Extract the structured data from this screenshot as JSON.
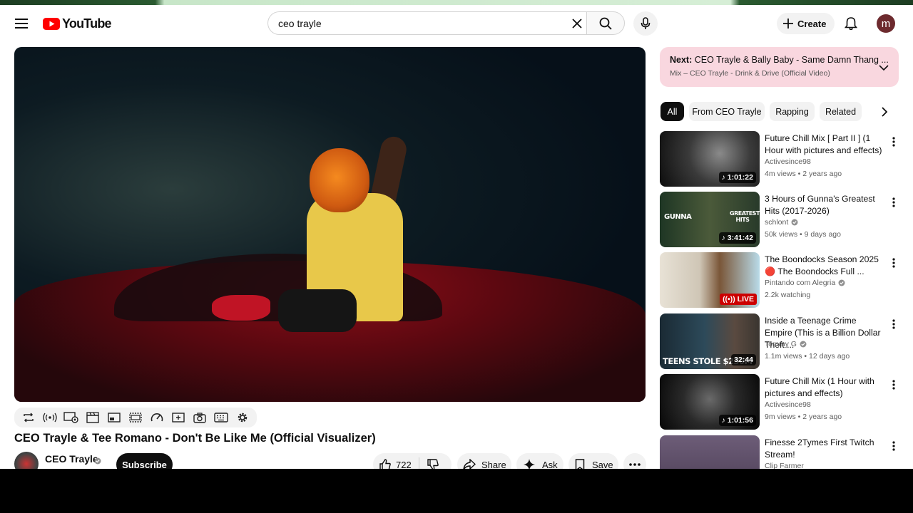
{
  "header": {
    "logo_text": "YouTube",
    "search_value": "ceo trayle",
    "create_label": "Create",
    "avatar_letter": "m"
  },
  "video": {
    "title": "CEO Trayle & Tee Romano - Don't Be Like Me (Official Visualizer)",
    "channel": "CEO Trayle",
    "subscribe_label": "Subscribe",
    "likes": "722",
    "share_label": "Share",
    "ask_label": "Ask",
    "save_label": "Save"
  },
  "next": {
    "prefix": "Next:",
    "title": "CEO Trayle & Bally Baby - Same Damn Thang ...",
    "subtitle": "Mix – CEO Trayle - Drink & Drive (Official Video)"
  },
  "chips": [
    "All",
    "From CEO Trayle",
    "Rapping",
    "Related"
  ],
  "recommendations": [
    {
      "title": "Future Chill Mix [ Part II ] (1 Hour with pictures and effects)",
      "channel": "Activesince98",
      "verified": false,
      "meta": "4m views • 2 years ago",
      "duration": "1:01:22",
      "mix": true
    },
    {
      "title": "3 Hours of Gunna's Greatest Hits (2017-2026)",
      "channel": "schlont",
      "verified": true,
      "meta": "50k views • 9 days ago",
      "duration": "3:41:42",
      "mix": true,
      "overlay_left": "GUNNA",
      "overlay_right": "GREATEST HITS"
    },
    {
      "title": "The Boondocks Season 2025 🔴 The Boondocks Full ...",
      "channel": "Pintando com Alegria",
      "verified": true,
      "meta": "2.2k watching",
      "live": "LIVE"
    },
    {
      "title": "Inside a Teenage Crime Empire (This is a Billion Dollar Theft ...",
      "channel": "Tommy G",
      "verified": true,
      "meta": "1.1m views • 12 days ago",
      "duration": "32:44",
      "overlay_left": "TEENS STOLE $230M"
    },
    {
      "title": "Future Chill Mix (1 Hour with pictures and effects)",
      "channel": "Activesince98",
      "verified": false,
      "meta": "9m views • 2 years ago",
      "duration": "1:01:56",
      "mix": true
    },
    {
      "title": "Finesse 2Tymes First Twitch Stream!",
      "channel": "Clip Farmer",
      "verified": false,
      "meta": ""
    }
  ],
  "colors": {
    "brand_red": "#ff0000",
    "next_bg": "#f9d7df",
    "live_red": "#cc0000"
  }
}
